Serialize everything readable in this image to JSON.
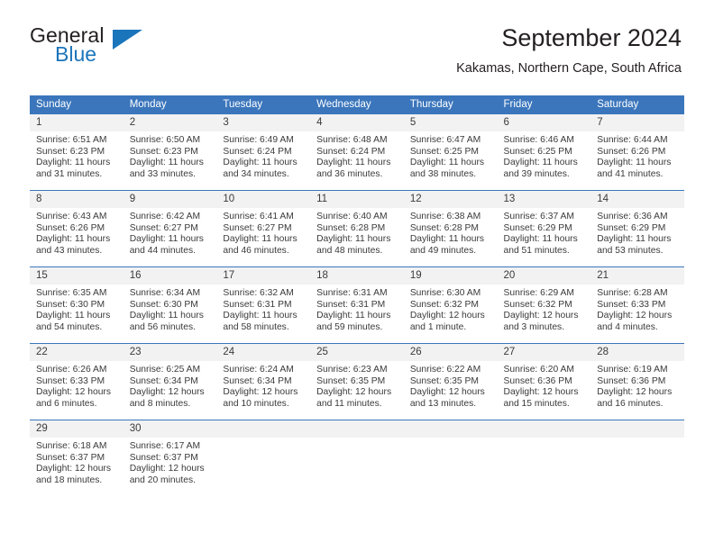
{
  "logo": {
    "word1": "General",
    "word2": "Blue",
    "accent": "#1b75bb"
  },
  "header": {
    "title": "September 2024",
    "subtitle": "Kakamas, Northern Cape, South Africa"
  },
  "calendar": {
    "header_bg": "#3b76bc",
    "daynum_bg": "#f2f2f2",
    "weekday_names": [
      "Sunday",
      "Monday",
      "Tuesday",
      "Wednesday",
      "Thursday",
      "Friday",
      "Saturday"
    ],
    "labels": {
      "sunrise": "Sunrise:",
      "sunset": "Sunset:",
      "daylight": "Daylight:"
    },
    "weeks": [
      [
        {
          "day": "1",
          "sunrise": "Sunrise: 6:51 AM",
          "sunset": "Sunset: 6:23 PM",
          "daylight1": "Daylight: 11 hours",
          "daylight2": "and 31 minutes."
        },
        {
          "day": "2",
          "sunrise": "Sunrise: 6:50 AM",
          "sunset": "Sunset: 6:23 PM",
          "daylight1": "Daylight: 11 hours",
          "daylight2": "and 33 minutes."
        },
        {
          "day": "3",
          "sunrise": "Sunrise: 6:49 AM",
          "sunset": "Sunset: 6:24 PM",
          "daylight1": "Daylight: 11 hours",
          "daylight2": "and 34 minutes."
        },
        {
          "day": "4",
          "sunrise": "Sunrise: 6:48 AM",
          "sunset": "Sunset: 6:24 PM",
          "daylight1": "Daylight: 11 hours",
          "daylight2": "and 36 minutes."
        },
        {
          "day": "5",
          "sunrise": "Sunrise: 6:47 AM",
          "sunset": "Sunset: 6:25 PM",
          "daylight1": "Daylight: 11 hours",
          "daylight2": "and 38 minutes."
        },
        {
          "day": "6",
          "sunrise": "Sunrise: 6:46 AM",
          "sunset": "Sunset: 6:25 PM",
          "daylight1": "Daylight: 11 hours",
          "daylight2": "and 39 minutes."
        },
        {
          "day": "7",
          "sunrise": "Sunrise: 6:44 AM",
          "sunset": "Sunset: 6:26 PM",
          "daylight1": "Daylight: 11 hours",
          "daylight2": "and 41 minutes."
        }
      ],
      [
        {
          "day": "8",
          "sunrise": "Sunrise: 6:43 AM",
          "sunset": "Sunset: 6:26 PM",
          "daylight1": "Daylight: 11 hours",
          "daylight2": "and 43 minutes."
        },
        {
          "day": "9",
          "sunrise": "Sunrise: 6:42 AM",
          "sunset": "Sunset: 6:27 PM",
          "daylight1": "Daylight: 11 hours",
          "daylight2": "and 44 minutes."
        },
        {
          "day": "10",
          "sunrise": "Sunrise: 6:41 AM",
          "sunset": "Sunset: 6:27 PM",
          "daylight1": "Daylight: 11 hours",
          "daylight2": "and 46 minutes."
        },
        {
          "day": "11",
          "sunrise": "Sunrise: 6:40 AM",
          "sunset": "Sunset: 6:28 PM",
          "daylight1": "Daylight: 11 hours",
          "daylight2": "and 48 minutes."
        },
        {
          "day": "12",
          "sunrise": "Sunrise: 6:38 AM",
          "sunset": "Sunset: 6:28 PM",
          "daylight1": "Daylight: 11 hours",
          "daylight2": "and 49 minutes."
        },
        {
          "day": "13",
          "sunrise": "Sunrise: 6:37 AM",
          "sunset": "Sunset: 6:29 PM",
          "daylight1": "Daylight: 11 hours",
          "daylight2": "and 51 minutes."
        },
        {
          "day": "14",
          "sunrise": "Sunrise: 6:36 AM",
          "sunset": "Sunset: 6:29 PM",
          "daylight1": "Daylight: 11 hours",
          "daylight2": "and 53 minutes."
        }
      ],
      [
        {
          "day": "15",
          "sunrise": "Sunrise: 6:35 AM",
          "sunset": "Sunset: 6:30 PM",
          "daylight1": "Daylight: 11 hours",
          "daylight2": "and 54 minutes."
        },
        {
          "day": "16",
          "sunrise": "Sunrise: 6:34 AM",
          "sunset": "Sunset: 6:30 PM",
          "daylight1": "Daylight: 11 hours",
          "daylight2": "and 56 minutes."
        },
        {
          "day": "17",
          "sunrise": "Sunrise: 6:32 AM",
          "sunset": "Sunset: 6:31 PM",
          "daylight1": "Daylight: 11 hours",
          "daylight2": "and 58 minutes."
        },
        {
          "day": "18",
          "sunrise": "Sunrise: 6:31 AM",
          "sunset": "Sunset: 6:31 PM",
          "daylight1": "Daylight: 11 hours",
          "daylight2": "and 59 minutes."
        },
        {
          "day": "19",
          "sunrise": "Sunrise: 6:30 AM",
          "sunset": "Sunset: 6:32 PM",
          "daylight1": "Daylight: 12 hours",
          "daylight2": "and 1 minute."
        },
        {
          "day": "20",
          "sunrise": "Sunrise: 6:29 AM",
          "sunset": "Sunset: 6:32 PM",
          "daylight1": "Daylight: 12 hours",
          "daylight2": "and 3 minutes."
        },
        {
          "day": "21",
          "sunrise": "Sunrise: 6:28 AM",
          "sunset": "Sunset: 6:33 PM",
          "daylight1": "Daylight: 12 hours",
          "daylight2": "and 4 minutes."
        }
      ],
      [
        {
          "day": "22",
          "sunrise": "Sunrise: 6:26 AM",
          "sunset": "Sunset: 6:33 PM",
          "daylight1": "Daylight: 12 hours",
          "daylight2": "and 6 minutes."
        },
        {
          "day": "23",
          "sunrise": "Sunrise: 6:25 AM",
          "sunset": "Sunset: 6:34 PM",
          "daylight1": "Daylight: 12 hours",
          "daylight2": "and 8 minutes."
        },
        {
          "day": "24",
          "sunrise": "Sunrise: 6:24 AM",
          "sunset": "Sunset: 6:34 PM",
          "daylight1": "Daylight: 12 hours",
          "daylight2": "and 10 minutes."
        },
        {
          "day": "25",
          "sunrise": "Sunrise: 6:23 AM",
          "sunset": "Sunset: 6:35 PM",
          "daylight1": "Daylight: 12 hours",
          "daylight2": "and 11 minutes."
        },
        {
          "day": "26",
          "sunrise": "Sunrise: 6:22 AM",
          "sunset": "Sunset: 6:35 PM",
          "daylight1": "Daylight: 12 hours",
          "daylight2": "and 13 minutes."
        },
        {
          "day": "27",
          "sunrise": "Sunrise: 6:20 AM",
          "sunset": "Sunset: 6:36 PM",
          "daylight1": "Daylight: 12 hours",
          "daylight2": "and 15 minutes."
        },
        {
          "day": "28",
          "sunrise": "Sunrise: 6:19 AM",
          "sunset": "Sunset: 6:36 PM",
          "daylight1": "Daylight: 12 hours",
          "daylight2": "and 16 minutes."
        }
      ],
      [
        {
          "day": "29",
          "sunrise": "Sunrise: 6:18 AM",
          "sunset": "Sunset: 6:37 PM",
          "daylight1": "Daylight: 12 hours",
          "daylight2": "and 18 minutes."
        },
        {
          "day": "30",
          "sunrise": "Sunrise: 6:17 AM",
          "sunset": "Sunset: 6:37 PM",
          "daylight1": "Daylight: 12 hours",
          "daylight2": "and 20 minutes."
        },
        {
          "day": "",
          "sunrise": "",
          "sunset": "",
          "daylight1": "",
          "daylight2": ""
        },
        {
          "day": "",
          "sunrise": "",
          "sunset": "",
          "daylight1": "",
          "daylight2": ""
        },
        {
          "day": "",
          "sunrise": "",
          "sunset": "",
          "daylight1": "",
          "daylight2": ""
        },
        {
          "day": "",
          "sunrise": "",
          "sunset": "",
          "daylight1": "",
          "daylight2": ""
        },
        {
          "day": "",
          "sunrise": "",
          "sunset": "",
          "daylight1": "",
          "daylight2": ""
        }
      ]
    ]
  }
}
